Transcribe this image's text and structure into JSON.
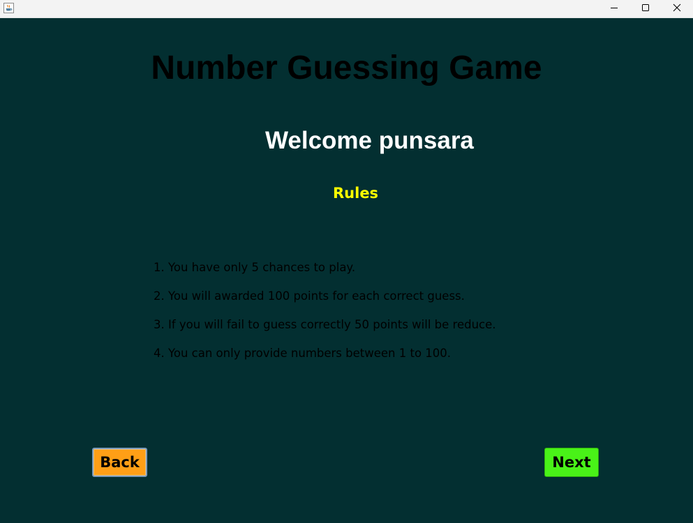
{
  "window": {
    "app_icon": "java-cup-icon",
    "controls": [
      "minimize-icon",
      "maximize-icon",
      "close-icon"
    ]
  },
  "game": {
    "title": "Number Guessing Game",
    "welcome": "Welcome punsara",
    "rules_heading": "Rules",
    "rules": [
      "1. You have only 5 chances to play.",
      "2. You will awarded 100 points for each correct guess.",
      "3. If you will fail to guess correctly 50 points will be reduce.",
      "4. You can only provide numbers between 1 to 100."
    ]
  },
  "buttons": {
    "back_label": "Back",
    "next_label": "Next"
  },
  "colors": {
    "background": "#032f31",
    "title": "#000000",
    "welcome": "#ffffff",
    "rules_heading": "#ffff00",
    "back_button": "#ff9f16",
    "next_button": "#49f218"
  }
}
